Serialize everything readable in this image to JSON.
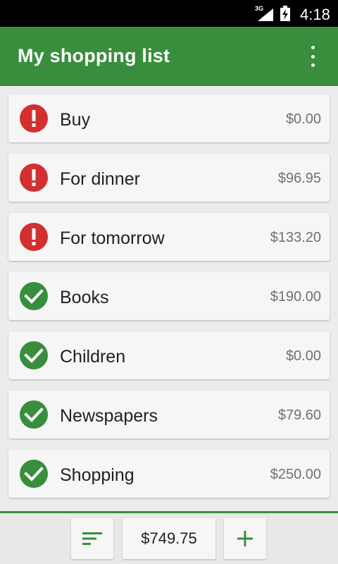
{
  "status_bar": {
    "network": "3G",
    "time": "4:18"
  },
  "app_bar": {
    "title": "My shopping list",
    "menu_icon": "more-vert-icon"
  },
  "lists": [
    {
      "name": "Buy",
      "price": "$0.00",
      "status": "alert"
    },
    {
      "name": "For dinner",
      "price": "$96.95",
      "status": "alert"
    },
    {
      "name": "For tomorrow",
      "price": "$133.20",
      "status": "alert"
    },
    {
      "name": "Books",
      "price": "$190.00",
      "status": "done"
    },
    {
      "name": "Children",
      "price": "$0.00",
      "status": "done"
    },
    {
      "name": "Newspapers",
      "price": "$79.60",
      "status": "done"
    },
    {
      "name": "Shopping",
      "price": "$250.00",
      "status": "done"
    }
  ],
  "bottom_bar": {
    "sort_icon": "sort-icon",
    "total": "$749.75",
    "add_icon": "plus-icon"
  },
  "colors": {
    "primary": "#388e3c",
    "alert": "#d32f2f",
    "done": "#388e3c"
  }
}
